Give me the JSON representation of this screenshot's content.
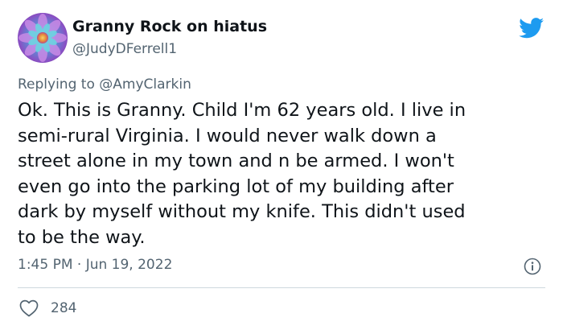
{
  "author": {
    "display_name": "Granny Rock on hiatus",
    "handle": "@JudyDFerrell1",
    "avatar_icon": "flower-mandala-avatar"
  },
  "platform_icon": "twitter-bird-icon",
  "brand_color": "#1d9bf0",
  "reply": {
    "prefix": "Replying to",
    "mention": "@AmyClarkin"
  },
  "tweet": {
    "lines": [
      "Ok. This is Granny. Child I'm 62 years old. I live in",
      "semi-rural Virginia. I would never walk down a",
      "street alone in my town and n be armed. I won't",
      "even go into the parking lot of my building after",
      "dark by myself without my knife. This didn't used",
      "to be the way."
    ],
    "timestamp": "1:45 PM · Jun 19, 2022"
  },
  "actions": {
    "info_icon": "info-icon",
    "like_icon": "heart-icon",
    "like_count": "284"
  }
}
